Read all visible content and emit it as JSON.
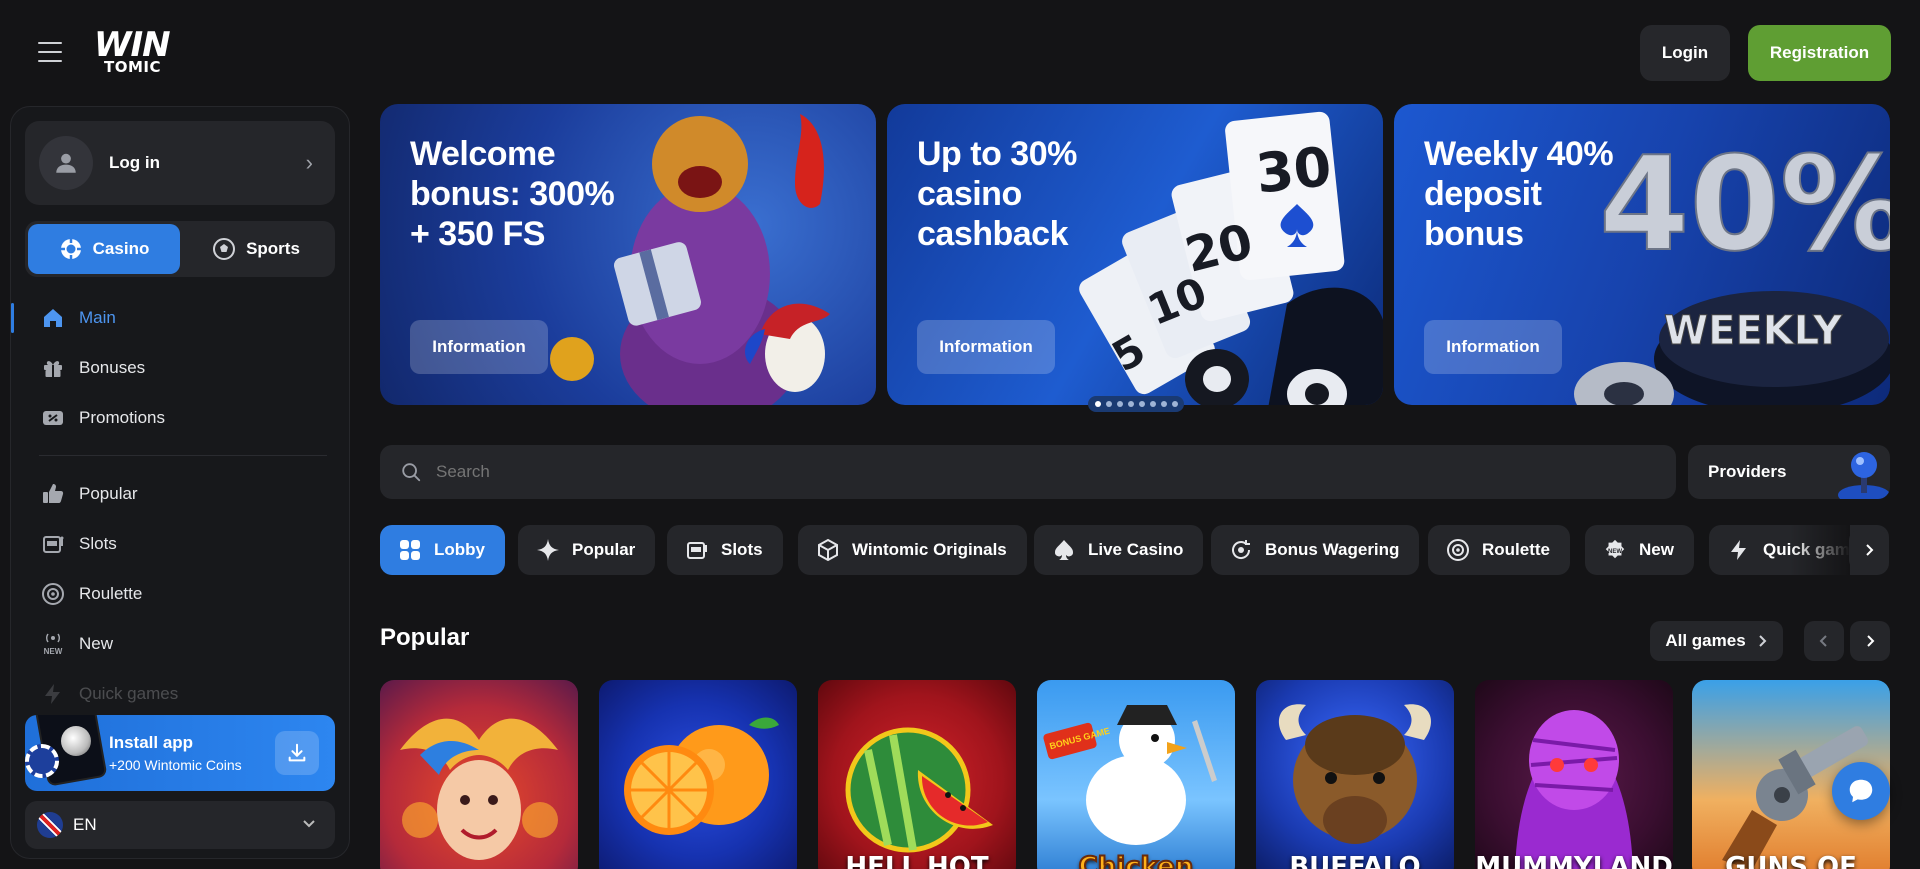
{
  "header": {
    "logo_line1": "WIN",
    "logo_line2": "TOMIC",
    "login_label": "Login",
    "registration_label": "Registration"
  },
  "sidebar": {
    "login_label": "Log in",
    "modes": [
      {
        "label": "Casino",
        "active": true
      },
      {
        "label": "Sports",
        "active": false
      }
    ],
    "nav_primary": [
      {
        "label": "Main",
        "icon": "home-icon",
        "active": true
      },
      {
        "label": "Bonuses",
        "icon": "gift-icon"
      },
      {
        "label": "Promotions",
        "icon": "ticket-icon"
      }
    ],
    "nav_secondary": [
      {
        "label": "Popular",
        "icon": "thumbs-up-icon"
      },
      {
        "label": "Slots",
        "icon": "slot-machine-icon"
      },
      {
        "label": "Roulette",
        "icon": "roulette-icon"
      },
      {
        "label": "New",
        "icon": "new-badge-icon"
      },
      {
        "label": "Quick games",
        "icon": "lightning-icon"
      }
    ],
    "install": {
      "title": "Install app",
      "subtitle": "+200 Wintomic Coins"
    },
    "language": "EN"
  },
  "banners": [
    {
      "title": "Welcome bonus: 300% + 350 FS",
      "button": "Information"
    },
    {
      "title": "Up to 30% casino cashback",
      "button": "Information"
    },
    {
      "title": "Weekly 40% deposit bonus",
      "button": "Information"
    }
  ],
  "banner_art": {
    "cards": [
      "5",
      "10",
      "20",
      "30"
    ],
    "big_percent": "40%",
    "weekly": "WEEKLY",
    "dots_total": 8,
    "dots_active": 0
  },
  "search": {
    "placeholder": "Search"
  },
  "providers_label": "Providers",
  "categories": [
    {
      "label": "Lobby",
      "icon": "lobby-grid-icon",
      "active": true
    },
    {
      "label": "Popular",
      "icon": "sparkle-icon"
    },
    {
      "label": "Slots",
      "icon": "slot-machine-icon"
    },
    {
      "label": "Wintomic Originals",
      "icon": "cube-icon"
    },
    {
      "label": "Live Casino",
      "icon": "spade-icon"
    },
    {
      "label": "Bonus Wagering",
      "icon": "bonus-wager-icon"
    },
    {
      "label": "Roulette",
      "icon": "roulette-icon"
    },
    {
      "label": "New",
      "icon": "new-badge-icon"
    },
    {
      "label": "Quick games",
      "icon": "lightning-icon"
    }
  ],
  "popular": {
    "title": "Popular",
    "all_games_label": "All games",
    "games": [
      {
        "name": "jester-game",
        "caption": ""
      },
      {
        "name": "orange-game",
        "caption": ""
      },
      {
        "name": "hell-hot-game",
        "caption": "HELL HOT"
      },
      {
        "name": "chicken-game",
        "caption": "Chicken",
        "badge": "BONUS GAME"
      },
      {
        "name": "buffalo-game",
        "caption": "BUFFALO"
      },
      {
        "name": "mummyland-game",
        "caption": "MUMMYLAND"
      },
      {
        "name": "guns-game",
        "caption": "GUNS OF"
      }
    ]
  },
  "colors": {
    "accent": "#2f7de1",
    "registration": "#5f9e33",
    "surface": "#25262a",
    "background": "#141416"
  }
}
